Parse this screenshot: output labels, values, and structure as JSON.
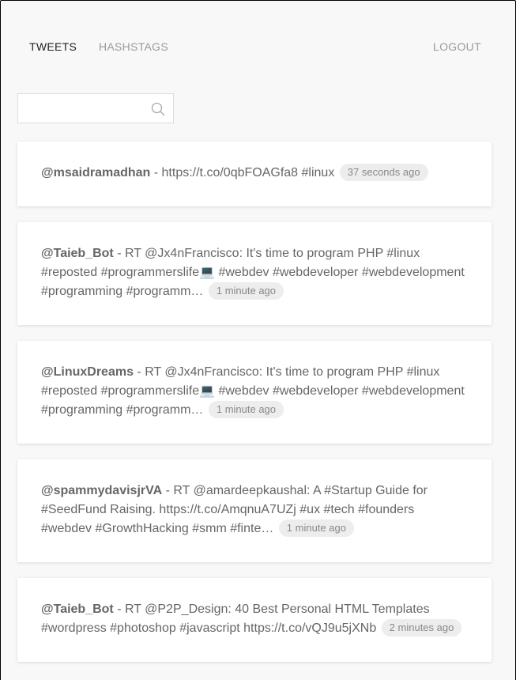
{
  "nav": {
    "tweets_label": "TWEETS",
    "hashtags_label": "HASHSTAGS",
    "logout_label": "LOGOUT"
  },
  "search": {
    "placeholder": "",
    "value": ""
  },
  "tweets": [
    {
      "user": "@msaidramadhan",
      "text": " - https://t.co/0qbFOAGfa8 #linux ",
      "time": "37 seconds ago"
    },
    {
      "user": "@Taieb_Bot",
      "text": " - RT @Jx4nFrancisco: It's time to program PHP #linux #reposted #programmerslife💻 #webdev #webdeveloper #webdevelopment #programming #programm… ",
      "time": "1 minute ago"
    },
    {
      "user": "@LinuxDreams",
      "text": " - RT @Jx4nFrancisco: It's time to program PHP #linux #reposted #programmerslife💻 #webdev #webdeveloper #webdevelopment #programming #programm… ",
      "time": "1 minute ago"
    },
    {
      "user": "@spammydavisjrVA",
      "text": " - RT @amardeepkaushal: A #Startup Guide for #SeedFund Raising. https://t.co/AmqnuA7UZj #ux #tech #founders #webdev #GrowthHacking #smm #finte… ",
      "time": "1 minute ago"
    },
    {
      "user": "@Taieb_Bot",
      "text": " - RT @P2P_Design: 40 Best Personal HTML Templates #wordpress #photoshop #javascript https://t.co/vQJ9u5jXNb ",
      "time": "2 minutes ago"
    }
  ]
}
